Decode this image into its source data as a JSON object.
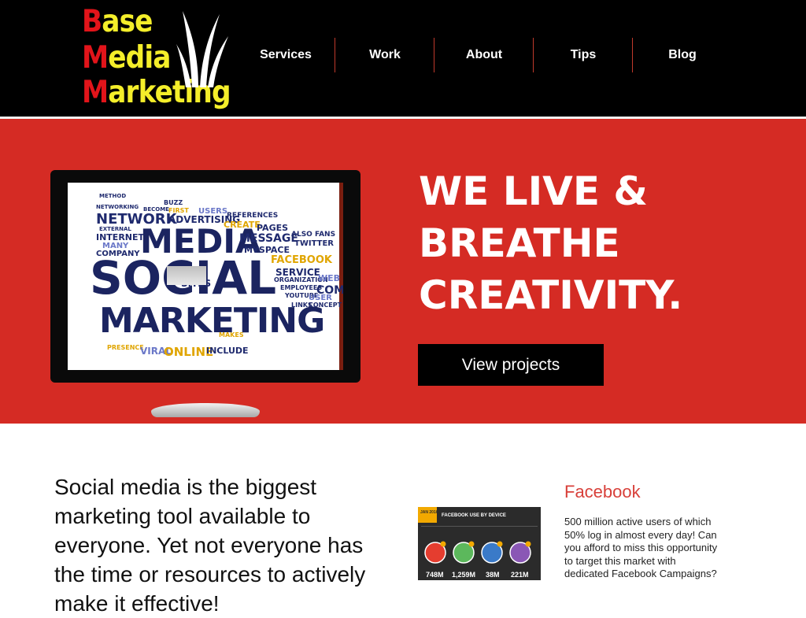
{
  "logo": {
    "lines": [
      {
        "first": "B",
        "rest": "ase"
      },
      {
        "first": "M",
        "rest": "edia"
      },
      {
        "first": "M",
        "rest": "arketing"
      }
    ]
  },
  "nav": {
    "items": [
      {
        "label": "Services"
      },
      {
        "label": "Work"
      },
      {
        "label": "About"
      },
      {
        "label": "Tips"
      },
      {
        "label": "Blog"
      }
    ]
  },
  "hero": {
    "headline": [
      "WE LIVE &",
      "BREATHE",
      "CREATIVITY."
    ],
    "cta_label": "View projects",
    "word_cloud": [
      "METHOD",
      "NETWORKING",
      "BECOME",
      "BUZZ",
      "FIRST",
      "USERS",
      "NETWORK",
      "ADVERTISING",
      "REFERENCES",
      "CREATE",
      "PAGES",
      "EXTERNAL",
      "INTERNET",
      "MEDIA",
      "MESSAGE",
      "ALSO FANS",
      "TWITTER",
      "MANY",
      "MYSPACE",
      "COMPANY",
      "FACEBOOK",
      "SOCIAL",
      "SERVICE",
      "ORGANIZATION",
      "WEB",
      "COMP",
      "SITES",
      "EMPLOYEES",
      "YOUTUBE",
      "USER",
      "LINKS",
      "CONCEPT",
      "MARKETING",
      "MAKES",
      "PRESENCE",
      "VIRAL",
      "ONLINE",
      "INCLUDE"
    ]
  },
  "intro": {
    "text": "Social media is the biggest marketing tool available to everyone. Yet not everyone has the time or resources to actively make it effective!"
  },
  "facebook": {
    "title": "Facebook",
    "text": "500 million active users of which 50% log in almost every day! Can you afford to miss this opportunity to target this market with dedicated Facebook Campaigns?"
  },
  "infographic": {
    "badge": "JAN 2016",
    "title": "FACEBOOK USE BY DEVICE",
    "stats": [
      "748M",
      "1,259M",
      "38M",
      "221M"
    ]
  }
}
